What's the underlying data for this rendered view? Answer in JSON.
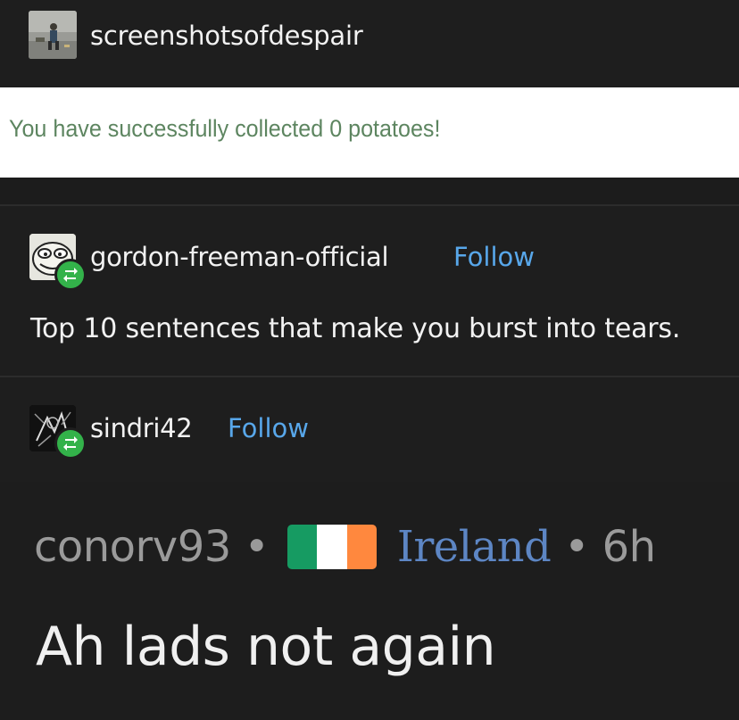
{
  "header": {
    "blog_name": "screenshotsofdespair",
    "avatar_icon": "beach-figure-avatar"
  },
  "notice": {
    "text": "You have successfully collected 0 potatoes!",
    "color": "#5d8560"
  },
  "posts": [
    {
      "username": "gordon-freeman-official",
      "follow_label": "Follow",
      "avatar_icon": "meme-face-avatar",
      "badge_icon": "reblog-icon",
      "text": "Top 10 sentences that make you burst into tears."
    },
    {
      "username": "sindri42",
      "follow_label": "Follow",
      "avatar_icon": "sketch-avatar",
      "badge_icon": "reblog-icon"
    }
  ],
  "comment": {
    "user": "conorv93",
    "separator": "•",
    "country": "Ireland",
    "flag_colors": [
      "#169b62",
      "#ffffff",
      "#ff883e"
    ],
    "time": "6h",
    "body": "Ah lads not again"
  },
  "colors": {
    "follow": "#58a7ea",
    "reblog_badge": "#33b24a",
    "background": "#1e1e1e"
  }
}
